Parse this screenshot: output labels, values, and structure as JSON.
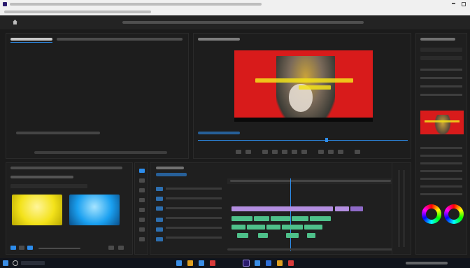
{
  "window": {
    "title": "",
    "menu": [
      "",
      "",
      "",
      "",
      "",
      "",
      "",
      "",
      ""
    ],
    "controls": [
      "",
      ""
    ]
  },
  "workspace_tabs": [
    "",
    "",
    "",
    "",
    "",
    "",
    "",
    "",
    "",
    ""
  ],
  "source_panel": {
    "tabs": [
      "",
      "",
      "",
      "",
      ""
    ],
    "timecode_left": "",
    "timecode_right": ""
  },
  "program_monitor": {
    "title": "",
    "timecode_left": "",
    "timecode_right": "",
    "overlay_caption_line1": "",
    "overlay_caption_line2": ""
  },
  "project_panel": {
    "tabs": [
      "",
      "",
      ""
    ],
    "project_name": "",
    "items": [
      {
        "name": "",
        "duration": "",
        "color": "#f3e21a"
      },
      {
        "name": "",
        "duration": "",
        "color": "#1aa0f0"
      }
    ]
  },
  "timeline": {
    "title": "",
    "timecode": "",
    "ruler": [
      "",
      "",
      "",
      "",
      "",
      "",
      "",
      ""
    ],
    "tracks": [
      "",
      "",
      "",
      "",
      "",
      "",
      ""
    ]
  },
  "right_panel": {
    "sections": [
      "",
      "",
      "",
      "",
      "",
      ""
    ]
  },
  "taskbar": {
    "search_placeholder": "",
    "clock": ""
  },
  "colors": {
    "accent": "#2d8ceb",
    "video_clip": "#b38ee0",
    "audio_clip": "#4ec08a",
    "frame_red": "#d81b1b"
  }
}
